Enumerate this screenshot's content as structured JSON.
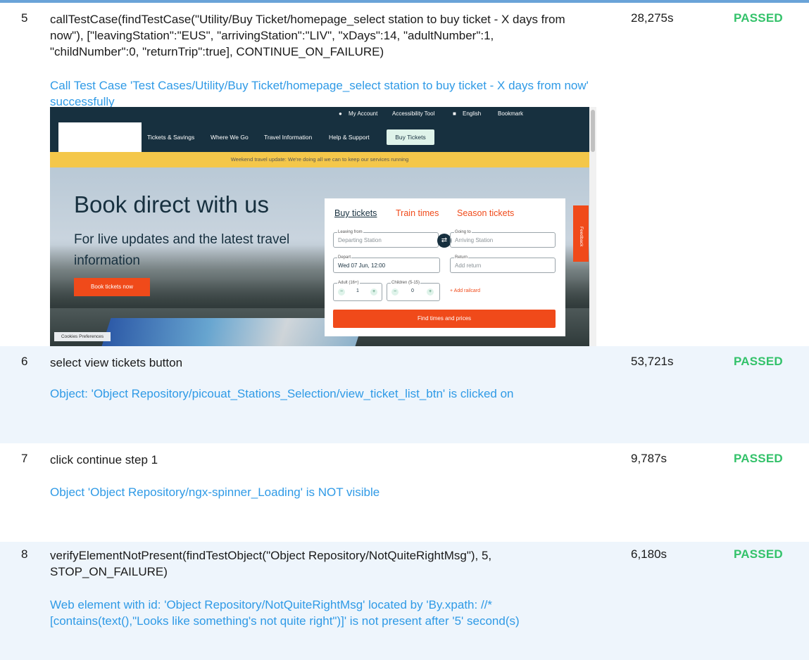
{
  "steps": [
    {
      "num": "5",
      "title": "callTestCase(findTestCase(\"Utility/Buy Ticket/homepage_select station to buy ticket - X days from now\"), [\"leavingStation\":\"EUS\", \"arrivingStation\":\"LIV\", \"xDays\":14, \"adultNumber\":1, \"childNumber\":0, \"returnTrip\":true], CONTINUE_ON_FAILURE)",
      "desc": "Call Test Case 'Test Cases/Utility/Buy Ticket/homepage_select station to buy ticket - X days from now' successfully",
      "duration": "28,275s",
      "status": "PASSED"
    },
    {
      "num": "6",
      "title": "select view tickets button",
      "desc": "Object: 'Object Repository/picouat_Stations_Selection/view_ticket_list_btn' is clicked on",
      "duration": "53,721s",
      "status": "PASSED"
    },
    {
      "num": "7",
      "title": "click continue step 1",
      "desc": "Object 'Object Repository/ngx-spinner_Loading' is NOT visible",
      "duration": "9,787s",
      "status": "PASSED"
    },
    {
      "num": "8",
      "title": "verifyElementNotPresent(findTestObject(\"Object Repository/NotQuiteRightMsg\"), 5, STOP_ON_FAILURE)",
      "desc": "Web element with id: 'Object Repository/NotQuiteRightMsg' located by 'By.xpath: //*[contains(text(),\"Looks like something's not quite right\")]' is not present after '5' second(s)",
      "duration": "6,180s",
      "status": "PASSED"
    }
  ],
  "screenshot": {
    "topbar": {
      "my_account": "My Account",
      "accessibility": "Accessibility Tool",
      "language": "English",
      "bookmark": "Bookmark"
    },
    "nav": {
      "tickets": "Tickets & Savings",
      "where": "Where We Go",
      "travel": "Travel Information",
      "help": "Help & Support",
      "buy": "Buy Tickets"
    },
    "banner": "Weekend travel update: We're doing all we can to keep our services running",
    "hero": {
      "heading": "Book direct with us",
      "subheading": "For live updates and the latest travel information",
      "cta": "Book tickets now",
      "cookies": "Cookies Preferences"
    },
    "card": {
      "tab_buy": "Buy tickets",
      "tab_times": "Train times",
      "tab_season": "Season tickets",
      "leaving_label": "Leaving from",
      "leaving_placeholder": "Departing Station",
      "going_label": "Going to",
      "going_placeholder": "Arriving Station",
      "depart_label": "Depart",
      "depart_value": "Wed 07 Jun, 12:00",
      "return_label": "Return",
      "return_placeholder": "Add return",
      "adult_label": "Adult (16+)",
      "adult_count": "1",
      "child_label": "Children (5-15)",
      "child_count": "0",
      "railcard": "+ Add railcard",
      "find": "Find times and prices",
      "feedback": "Feedback"
    },
    "colors": {
      "navy": "#17303f",
      "orange": "#f04a1a",
      "yellow": "#f4c74a"
    }
  },
  "colors": {
    "status_passed": "#33c26a",
    "description_blue": "#2f9ae6",
    "row_alt_bg": "#eef5fc"
  }
}
